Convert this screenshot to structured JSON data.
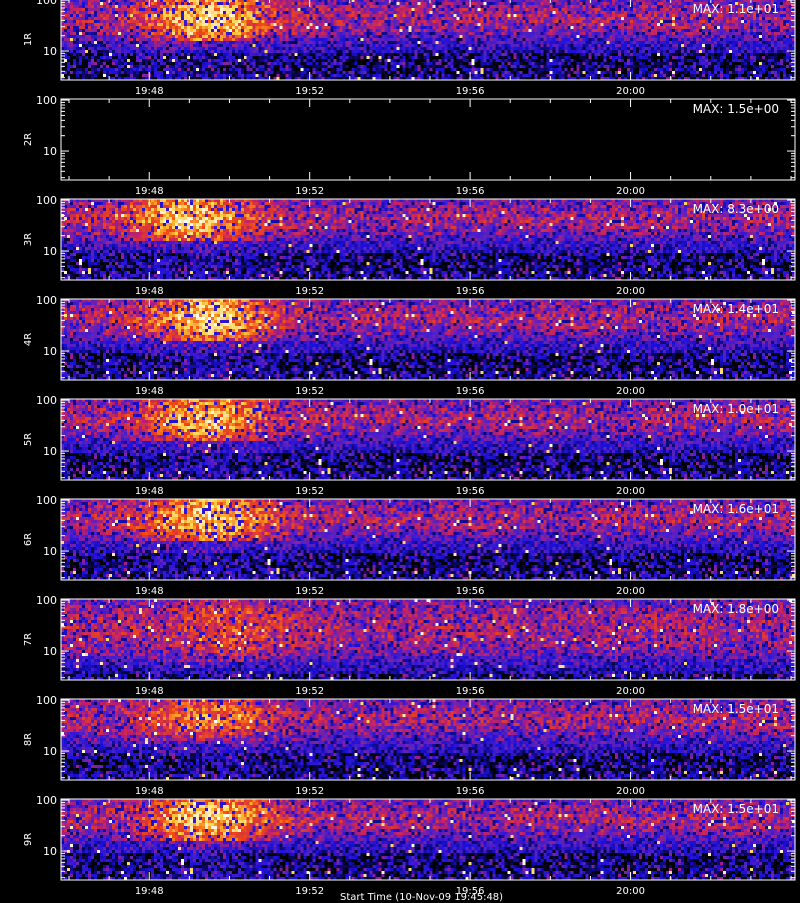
{
  "chart_data": {
    "type": "heatmap",
    "colormap": [
      "#000000",
      "#1a0fd8",
      "#5020c8",
      "#c0206a",
      "#f04a10",
      "#ffd040",
      "#ffffff"
    ],
    "x_ticks": [
      "19:48",
      "19:52",
      "19:56",
      "20:00"
    ],
    "x_tick_minutes": [
      48,
      52,
      56,
      60
    ],
    "x_range_minutes": [
      45.8,
      64.1
    ],
    "y_scale": "log",
    "y_ticks": [
      "100",
      "10"
    ],
    "y_tick_values": [
      100,
      10
    ],
    "y_range": [
      2.7,
      105
    ],
    "footer": "Start Time (10-Nov-09 19:45:48)",
    "panels": [
      {
        "label": "1R",
        "max_label": "MAX: 1.1e+01",
        "max": 11,
        "band": [
          20,
          100
        ],
        "burst_minute": 49.5,
        "burst_strength": 1.0
      },
      {
        "label": "2R",
        "max_label": "MAX: 1.5e+00",
        "max": 1.5,
        "band": [
          10,
          100
        ],
        "burst_minute": 49.5,
        "burst_strength": 0.0,
        "empty": true
      },
      {
        "label": "3R",
        "max_label": "MAX: 8.3e+00",
        "max": 8.3,
        "band": [
          20,
          100
        ],
        "burst_minute": 49.0,
        "burst_strength": 1.0
      },
      {
        "label": "4R",
        "max_label": "MAX: 1.4e+01",
        "max": 14,
        "band": [
          20,
          100
        ],
        "burst_minute": 49.5,
        "burst_strength": 1.0
      },
      {
        "label": "5R",
        "max_label": "MAX: 1.0e+01",
        "max": 10,
        "band": [
          20,
          100
        ],
        "burst_minute": 49.5,
        "burst_strength": 0.9
      },
      {
        "label": "6R",
        "max_label": "MAX: 1.6e+01",
        "max": 16,
        "band": [
          20,
          100
        ],
        "burst_minute": 49.5,
        "burst_strength": 1.0
      },
      {
        "label": "7R",
        "max_label": "MAX: 1.8e+00",
        "max": 1.8,
        "band": [
          8,
          100
        ],
        "burst_minute": 50.0,
        "burst_strength": 0.4
      },
      {
        "label": "8R",
        "max_label": "MAX: 1.5e+01",
        "max": 15,
        "band": [
          20,
          100
        ],
        "burst_minute": 49.5,
        "burst_strength": 0.6
      },
      {
        "label": "9R",
        "max_label": "MAX: 1.5e+01",
        "max": 15,
        "band": [
          20,
          100
        ],
        "burst_minute": 49.5,
        "burst_strength": 1.0
      }
    ]
  }
}
